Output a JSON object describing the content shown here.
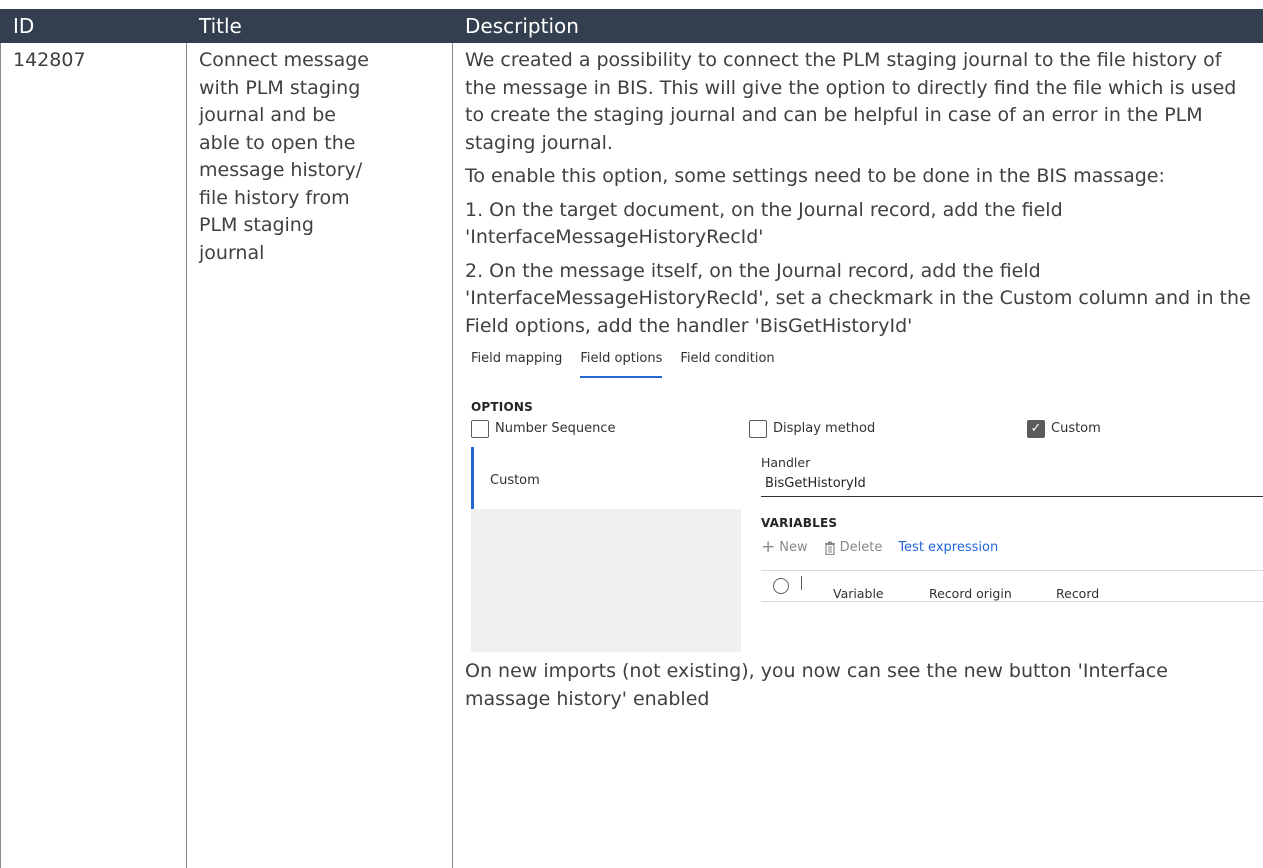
{
  "table": {
    "headers": {
      "id": "ID",
      "title": "Title",
      "description": "Description"
    },
    "row": {
      "id": "142807",
      "title_lines": [
        "Connect message",
        "with PLM staging",
        "journal and be",
        "able to open the",
        "message history/",
        "file history from",
        "PLM staging",
        "journal"
      ],
      "description": {
        "p1": "We created a possibility to connect the PLM staging journal to the file history of the message in BIS. This will give the option to directly find the file which is used to create the staging journal and can be helpful in case of an error in the PLM staging journal.",
        "p2": "To enable this option, some settings need to be done in the BIS massage:",
        "p3": "1. On the target document, on the Journal record, add the field 'InterfaceMessageHistoryRecId'",
        "p4": "2. On the message itself, on the Journal record, add the field 'InterfaceMessageHistoryRecId', set a checkmark in the Custom column and in the Field options, add the handler 'BisGetHistoryId'",
        "p5": "On new imports (not existing), you now can see the new button 'Interface massage history' enabled"
      }
    }
  },
  "screenshot": {
    "tabs": [
      "Field mapping",
      "Field options",
      "Field condition"
    ],
    "active_tab": 1,
    "options_title": "OPTIONS",
    "checkboxes": [
      {
        "label": "Number Sequence",
        "checked": false
      },
      {
        "label": "Display method",
        "checked": false
      },
      {
        "label": "Custom",
        "checked": true
      }
    ],
    "side_item": "Custom",
    "handler_label": "Handler",
    "handler_value": "BisGetHistoryId",
    "variables_title": "VARIABLES",
    "toolbar": {
      "new": "New",
      "delete": "Delete",
      "test": "Test expression"
    },
    "grid_columns": [
      "Variable",
      "Record origin",
      "Record"
    ],
    "accent_color": "#2266d8",
    "header_color": "#333f4f"
  }
}
